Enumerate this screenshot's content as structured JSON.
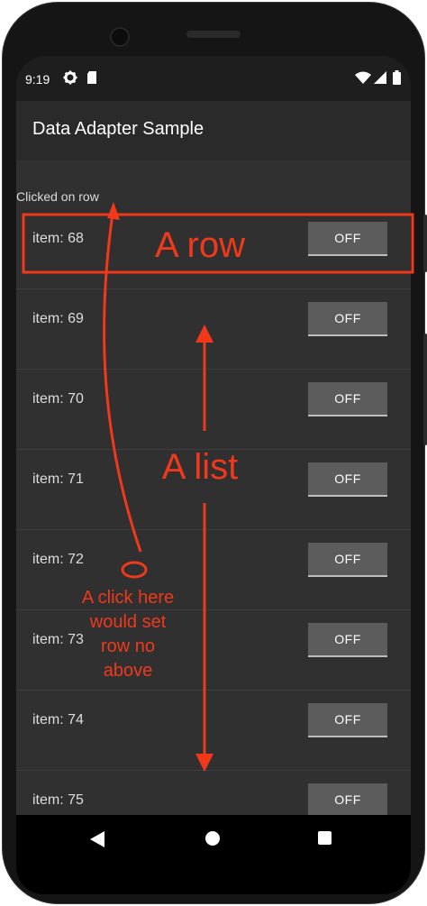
{
  "status_bar": {
    "time": "9:19",
    "icons": [
      "gear-icon",
      "sd-card-icon",
      "wifi-icon",
      "signal-icon",
      "battery-icon"
    ]
  },
  "app_bar": {
    "title": "Data Adapter Sample"
  },
  "clicked_text": "Clicked on row",
  "list": {
    "rows": [
      {
        "label": "item: 68",
        "button": "OFF"
      },
      {
        "label": "item: 69",
        "button": "OFF"
      },
      {
        "label": "item: 70",
        "button": "OFF"
      },
      {
        "label": "item: 71",
        "button": "OFF"
      },
      {
        "label": "item: 72",
        "button": "OFF"
      },
      {
        "label": "item: 73",
        "button": "OFF"
      },
      {
        "label": "item: 74",
        "button": "OFF"
      },
      {
        "label": "item: 75",
        "button": "OFF"
      }
    ]
  },
  "annotations": {
    "row_label": "A row",
    "list_label": "A list",
    "click_note": [
      "A click here",
      "would set",
      "row no",
      "above"
    ]
  },
  "colors": {
    "annotation": "#f0391b",
    "screen_bg": "#303030",
    "app_bar_bg": "#2a2a2a",
    "button_bg": "#5c5c5c"
  },
  "nav_bar": {
    "icons": [
      "back-icon",
      "home-icon",
      "recents-icon"
    ]
  }
}
